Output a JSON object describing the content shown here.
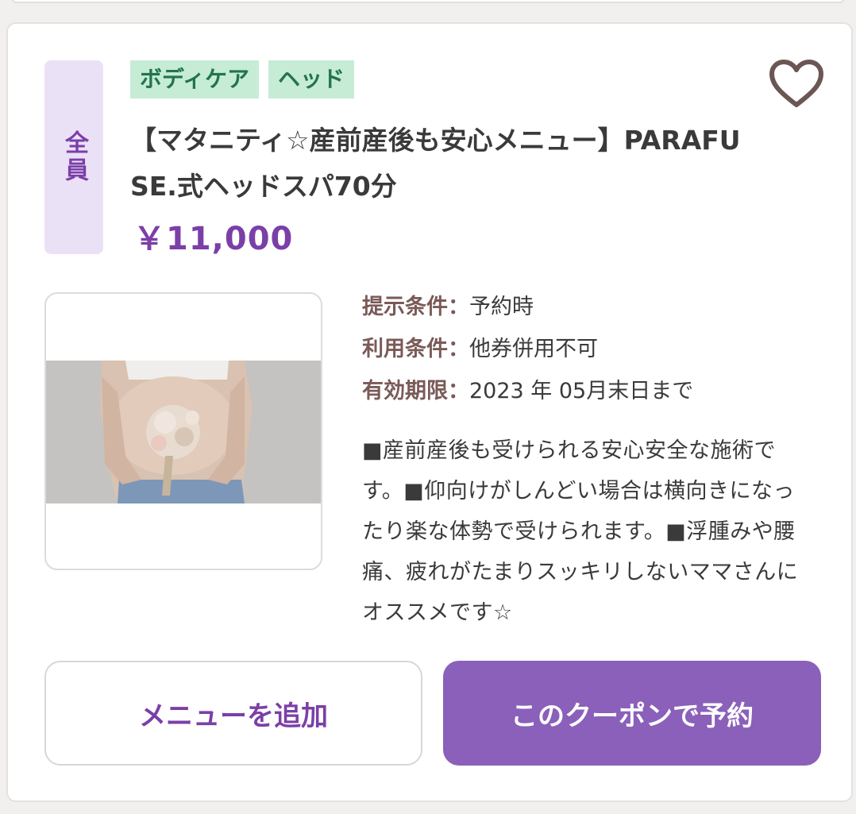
{
  "badge": {
    "label": "全員"
  },
  "tags": [
    "ボディケア",
    "ヘッド"
  ],
  "favorite_icon": "heart-icon",
  "coupon": {
    "title": "【マタニティ☆産前産後も安心メニュー】PARAFUSE.式ヘッドスパ70分",
    "price": "￥11,000"
  },
  "conditions": [
    {
      "key": "提示条件",
      "sep": "：",
      "value": "予約時"
    },
    {
      "key": "利用条件",
      "sep": "：",
      "value": "他券併用不可"
    },
    {
      "key": "有効期限",
      "sep": "：",
      "value": "2023 年 05月末日まで"
    }
  ],
  "description": "■産前産後も受けられる安心安全な施術です。■仰向けがしんどい場合は横向きになったり楽な体勢で受けられます。■浮腫みや腰痛、疲れがたまりスッキリしないママさんにオススメです☆",
  "buttons": {
    "add_menu": "メニューを追加",
    "reserve": "このクーポンで予約"
  },
  "colors": {
    "accent": "#7b3fa8",
    "reserve_button": "#8a60ba",
    "tag_bg": "#c6ecd6",
    "tag_text": "#23744a",
    "badge_bg": "#ebe1f7"
  }
}
